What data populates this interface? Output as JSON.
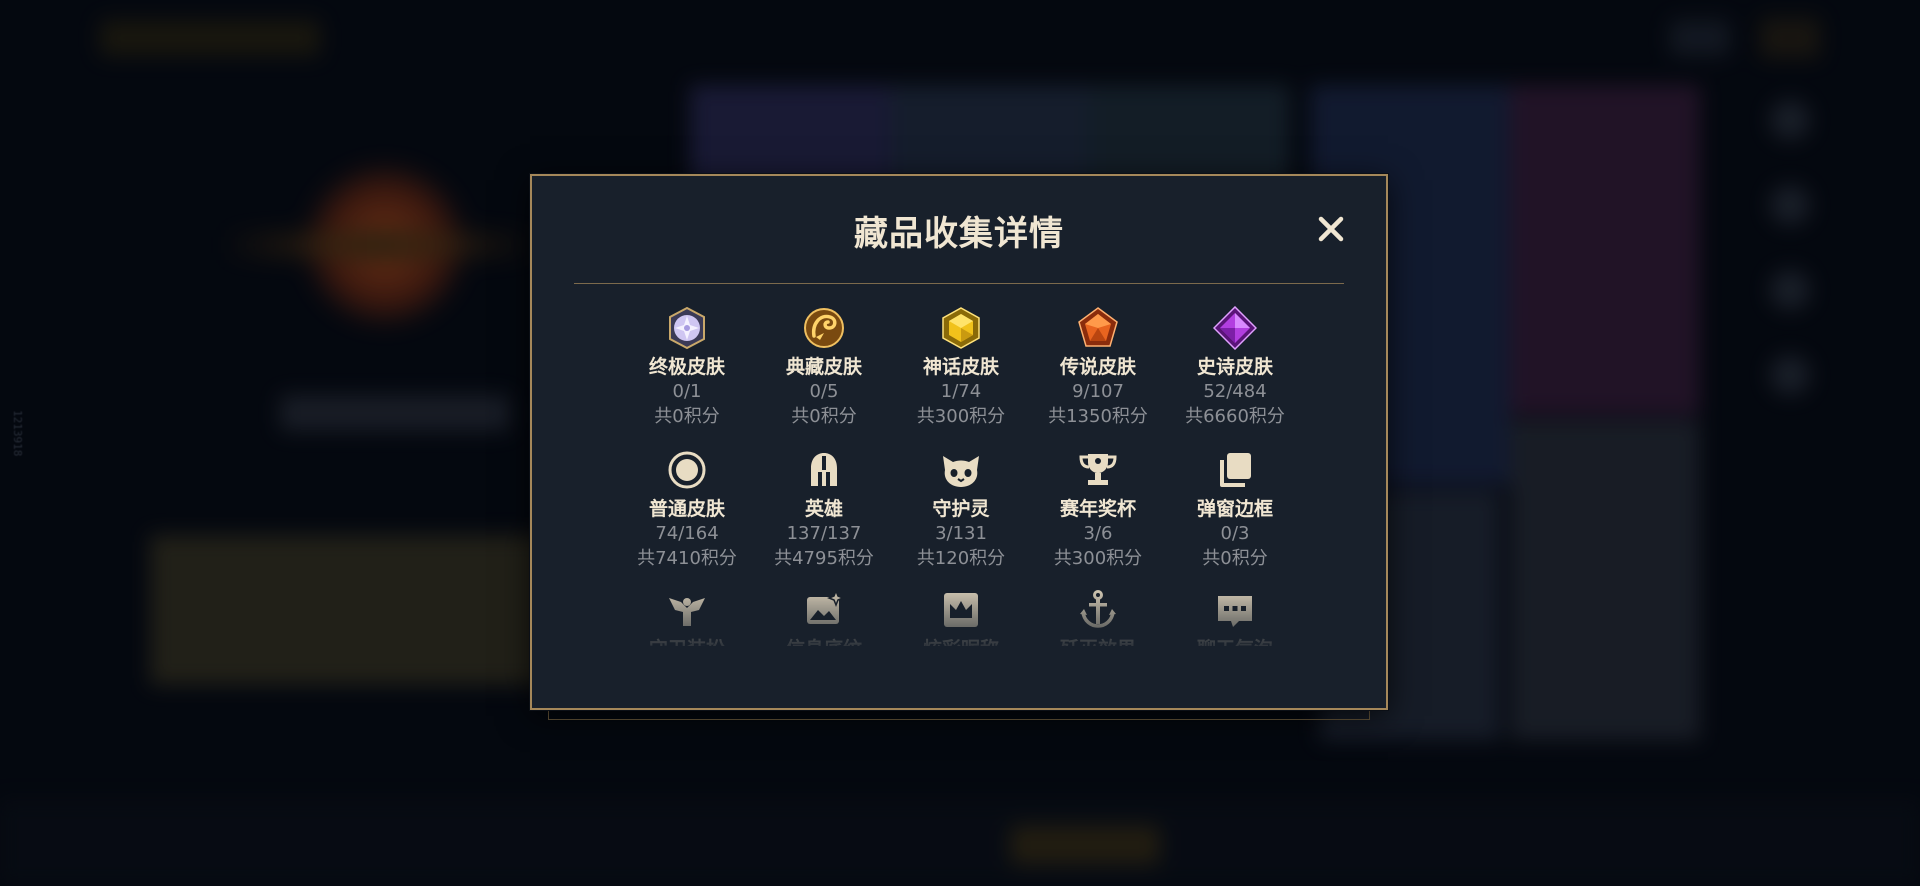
{
  "background": {
    "side_code": "1213918"
  },
  "modal": {
    "title": "藏品收集详情",
    "close_label": "✕",
    "items": [
      {
        "name": "终极皮肤",
        "count": "0/1",
        "points": "共0积分",
        "icon": "ultimate-gem-icon",
        "color": "#cfc6f2"
      },
      {
        "name": "典藏皮肤",
        "count": "0/5",
        "points": "共0积分",
        "icon": "dragon-emblem-icon",
        "color": "#e0a92b"
      },
      {
        "name": "神话皮肤",
        "count": "1/74",
        "points": "共300积分",
        "icon": "mythic-gem-icon",
        "color": "#f1c21b"
      },
      {
        "name": "传说皮肤",
        "count": "9/107",
        "points": "共1350积分",
        "icon": "legendary-gem-icon",
        "color": "#e8641f"
      },
      {
        "name": "史诗皮肤",
        "count": "52/484",
        "points": "共6660积分",
        "icon": "epic-gem-icon",
        "color": "#b23ee0"
      },
      {
        "name": "普通皮肤",
        "count": "74/164",
        "points": "共7410积分",
        "icon": "ring-icon",
        "color": "#e8dcc3"
      },
      {
        "name": "英雄",
        "count": "137/137",
        "points": "共4795积分",
        "icon": "helmet-icon",
        "color": "#e8dcc3"
      },
      {
        "name": "守护灵",
        "count": "3/131",
        "points": "共120积分",
        "icon": "cat-face-icon",
        "color": "#e8dcc3"
      },
      {
        "name": "赛年奖杯",
        "count": "3/6",
        "points": "共300积分",
        "icon": "trophy-icon",
        "color": "#e8dcc3"
      },
      {
        "name": "弹窗边框",
        "count": "0/3",
        "points": "共0积分",
        "icon": "stacked-frames-icon",
        "color": "#e8dcc3"
      },
      {
        "name": "守卫装扮",
        "count": "",
        "points": "",
        "icon": "ward-icon",
        "color": "#e8dcc3"
      },
      {
        "name": "信息底纹",
        "count": "",
        "points": "",
        "icon": "image-sparkle-icon",
        "color": "#e8dcc3"
      },
      {
        "name": "炫彩昵称",
        "count": "",
        "points": "",
        "icon": "crown-badge-icon",
        "color": "#e8dcc3"
      },
      {
        "name": "歼灭效果",
        "count": "",
        "points": "",
        "icon": "anchor-icon",
        "color": "#e8dcc3"
      },
      {
        "name": "聊天气泡",
        "count": "",
        "points": "",
        "icon": "chat-bubble-icon",
        "color": "#e8dcc3"
      }
    ]
  },
  "colors": {
    "gold_border": "#a5885a",
    "panel_bg": "#18202b",
    "title_text": "#f0e6d2",
    "muted_text": "#8d9096"
  }
}
